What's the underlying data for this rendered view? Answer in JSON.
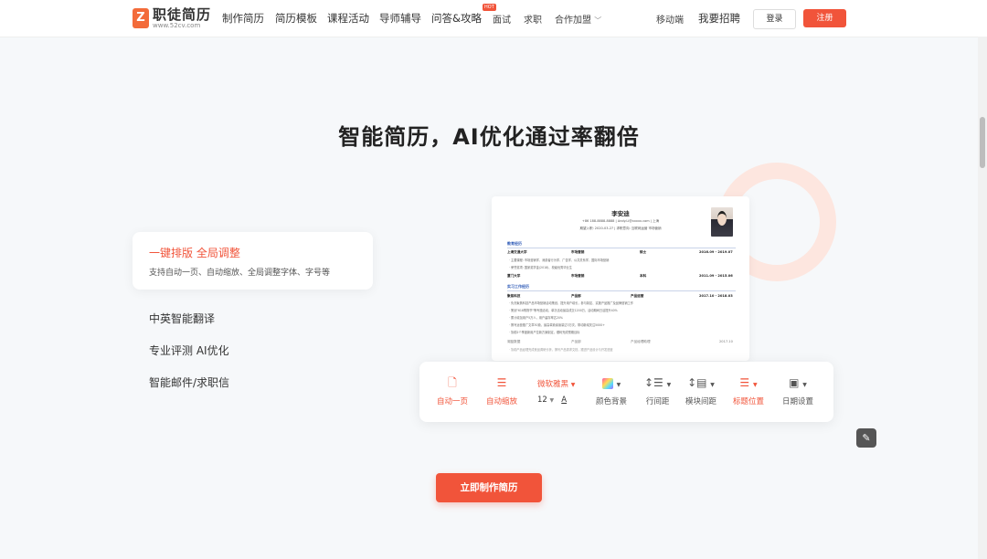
{
  "nav": {
    "logo_title": "职徒简历",
    "logo_sub": "www.52cv.com",
    "items": [
      "制作简历",
      "简历模板",
      "课程活动",
      "导师辅导",
      "问答&攻略",
      "面试",
      "求职",
      "合作加盟"
    ],
    "hot_badge": "HOT",
    "mobile": "移动端",
    "hiring": "我要招聘",
    "login": "登录",
    "register": "注册"
  },
  "heading": "智能简历，AI优化通过率翻倍",
  "features": {
    "active_title": "一键排版 全局调整",
    "active_desc": "支持自动一页、自动缩放、全局调整字体、字号等",
    "items": [
      "中英智能翻译",
      "专业评测 AI优化",
      "智能邮件/求职信"
    ]
  },
  "resume": {
    "name": "李安迪",
    "contact": "+86 188-8888-8888  |  Andy.Li@xxxxx.com  |  上海",
    "contact2": "期望入职: 2020-03-27  |  求职意向: 互联网运营  市场营销",
    "sec_edu": "教育经历",
    "edu1": [
      "上海交通大学",
      "市场营销",
      "硕士",
      "2016.09 - 2019.07"
    ],
    "edu1_l1": "· 主要课程: 市场营销学、消费者行为学、广告学、公共关系学、国际市场营销",
    "edu1_l2": "· 荣誉奖项: 国家奖学金(2018)、校级优秀毕业生",
    "edu2": [
      "厦门大学",
      "市场营销",
      "本科",
      "2011.09 - 2015.06"
    ],
    "sec_work": "实习工作经历",
    "work1": [
      "聚焦科技",
      "产品部",
      "产品运营",
      "2017.10 - 2018.03"
    ],
    "work1_l1": "· 负责聚焦科技产品市场营销活动策划，提升用户增长，参与制定、实施产品推广及品牌营销工作",
    "work1_l2": "· 策划\"618购物节\"等专题活动，单次活动最高成交1200万，活动期间日活提升40%",
    "work1_l3": "· 累计增加用户5万人，用户留存率达20%",
    "work1_l4": "· 撰写运营推广文章30篇，最高单篇阅读量达3万次，带动新增关注5000+",
    "work1_l5": "· 协助2个季度新用户拉新方案制定，顺利完成预期目标",
    "work2": [
      "湖蓝数据",
      "产品部",
      "产品经理助理",
      "2017.10"
    ],
    "work2_l1": "· 协助产品经理完成竞品调研分析，撰写产品需求文档，跟进产品设计与开发进度"
  },
  "toolbar": {
    "auto_page": "自动一页",
    "auto_scale": "自动缩放",
    "font_name": "微软雅黑",
    "font_size": "12",
    "color_bg": "颜色背景",
    "line_spacing": "行间距",
    "module_spacing": "模块间距",
    "title_position": "标题位置",
    "date_setting": "日期设置"
  },
  "cta": "立即制作简历",
  "colors": {
    "accent": "#f1543a",
    "link": "#2f5bb7",
    "background": "#f6f8fa"
  }
}
